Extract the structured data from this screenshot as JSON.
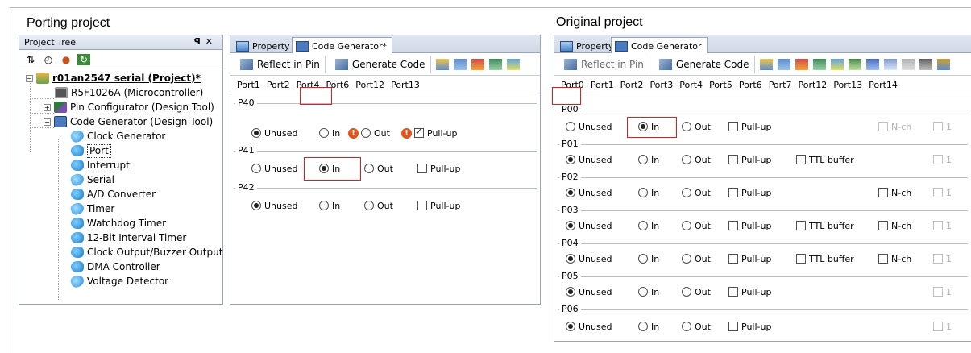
{
  "captions": {
    "left": "Porting project",
    "right": "Original project"
  },
  "project_tree": {
    "title": "Project Tree",
    "controls": "ꟼ X",
    "root": "r01an2547 serial (Project)*",
    "items": [
      {
        "label": "R5F1026A (Microcontroller)",
        "icon": "chip-icon"
      },
      {
        "label": "Pin Configurator (Design Tool)",
        "icon": "pin-tool-icon"
      },
      {
        "label": "Code Generator (Design Tool)",
        "icon": "code-generator-icon"
      }
    ],
    "children": [
      "Clock Generator",
      "Port",
      "Interrupt",
      "Serial",
      "A/D Converter",
      "Timer",
      "Watchdog Timer",
      "12-Bit Interval Timer",
      "Clock Output/Buzzer Output",
      "DMA Controller",
      "Voltage Detector"
    ]
  },
  "left_panel": {
    "tabs": [
      "Property",
      "Code Generator*"
    ],
    "toolbar": {
      "reflect": "Reflect in Pin",
      "generate": "Generate Code"
    },
    "port_tabs": [
      "Port1",
      "Port2",
      "Port4",
      "Port6",
      "Port12",
      "Port13"
    ],
    "groups": [
      {
        "name": "P40",
        "unused": "Unused",
        "in": "In",
        "out": "Out",
        "pullup": "Pull-up"
      },
      {
        "name": "P41",
        "unused": "Unused",
        "in": "In",
        "out": "Out",
        "pullup": "Pull-up"
      },
      {
        "name": "P42",
        "unused": "Unused",
        "in": "In",
        "out": "Out",
        "pullup": "Pull-up"
      }
    ]
  },
  "right_panel": {
    "tabs": [
      "Property",
      "Code Generator"
    ],
    "toolbar": {
      "reflect": "Reflect in Pin",
      "generate": "Generate Code"
    },
    "port_tabs": [
      "Port0",
      "Port1",
      "Port2",
      "Port3",
      "Port4",
      "Port5",
      "Port6",
      "Port7",
      "Port12",
      "Port13",
      "Port14"
    ],
    "groups": [
      {
        "name": "P00",
        "unused": "Unused",
        "in": "In",
        "out": "Out",
        "pullup": "Pull-up",
        "ttl": "",
        "nch": "N-ch",
        "v": "1"
      },
      {
        "name": "P01",
        "unused": "Unused",
        "in": "In",
        "out": "Out",
        "pullup": "Pull-up",
        "ttl": "TTL buffer",
        "nch": "",
        "v": "1"
      },
      {
        "name": "P02",
        "unused": "Unused",
        "in": "In",
        "out": "Out",
        "pullup": "Pull-up",
        "ttl": "",
        "nch": "N-ch",
        "v": "1"
      },
      {
        "name": "P03",
        "unused": "Unused",
        "in": "In",
        "out": "Out",
        "pullup": "Pull-up",
        "ttl": "TTL buffer",
        "nch": "N-ch",
        "v": "1"
      },
      {
        "name": "P04",
        "unused": "Unused",
        "in": "In",
        "out": "Out",
        "pullup": "Pull-up",
        "ttl": "TTL buffer",
        "nch": "N-ch",
        "v": "1"
      },
      {
        "name": "P05",
        "unused": "Unused",
        "in": "In",
        "out": "Out",
        "pullup": "Pull-up",
        "ttl": "",
        "nch": "",
        "v": "1"
      },
      {
        "name": "P06",
        "unused": "Unused",
        "in": "In",
        "out": "Out",
        "pullup": "Pull-up",
        "ttl": "",
        "nch": "",
        "v": "1"
      }
    ]
  }
}
